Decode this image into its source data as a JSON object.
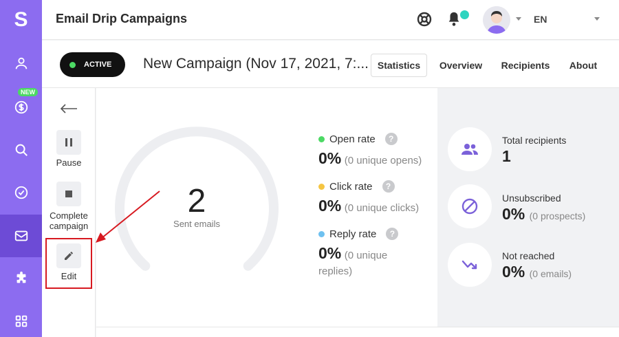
{
  "app": {
    "logo": "S",
    "title": "Email Drip Campaigns",
    "language": "EN"
  },
  "sidebar": {
    "new_badge": "NEW",
    "items": [
      {
        "icon": "user-icon"
      },
      {
        "icon": "dollar-icon"
      },
      {
        "icon": "search-icon"
      },
      {
        "icon": "check-circle-icon"
      },
      {
        "icon": "mail-icon",
        "active": true
      },
      {
        "icon": "puzzle-icon"
      },
      {
        "icon": "grid-icon"
      }
    ]
  },
  "campaign": {
    "status": "ACTIVE",
    "title": "New Campaign (Nov 17, 2021, 7:...",
    "tabs": [
      "Statistics",
      "Overview",
      "Recipients",
      "About"
    ],
    "active_tab": "Statistics"
  },
  "actions": {
    "pause": "Pause",
    "complete_line1": "Complete",
    "complete_line2": "campaign",
    "edit": "Edit"
  },
  "stats": {
    "sent_count": "2",
    "sent_label": "Sent emails",
    "help": "?",
    "open": {
      "label": "Open rate",
      "value": "0%",
      "sub": "(0 unique opens)",
      "color": "#4cd964"
    },
    "click": {
      "label": "Click rate",
      "value": "0%",
      "sub": "(0 unique clicks)",
      "color": "#f5c542"
    },
    "reply": {
      "label": "Reply rate",
      "value": "0%",
      "sub_line1": "(0 unique",
      "sub_line2": "replies)",
      "color": "#6ec1f0"
    }
  },
  "summary": {
    "total": {
      "label": "Total recipients",
      "value": "1"
    },
    "unsub": {
      "label": "Unsubscribed",
      "value": "0%",
      "sub": "(0 prospects)"
    },
    "notreached": {
      "label": "Not reached",
      "value": "0%",
      "sub": "(0 emails)"
    }
  },
  "colors": {
    "rail": "#8c6cf0",
    "rail_active": "#6d4bd6",
    "accent_icon": "#7b61d9",
    "annotation": "#d71920"
  }
}
